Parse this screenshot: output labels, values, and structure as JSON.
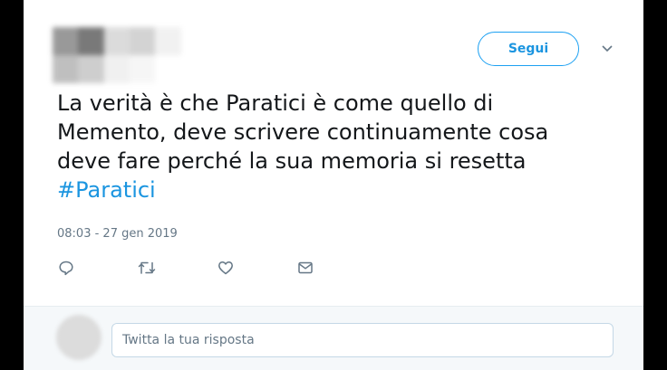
{
  "header": {
    "follow_label": "Segui"
  },
  "tweet": {
    "lines": [
      "La verità è che Paratici è come quello di",
      "Memento, deve scrivere continuamente cosa",
      "deve fare perché la sua memoria si resetta"
    ],
    "hashtag": "#Paratici",
    "timestamp": "08:03 - 27 gen 2019"
  },
  "actions": [
    "reply-icon",
    "retweet-icon",
    "like-icon",
    "message-icon"
  ],
  "reply": {
    "placeholder": "Twitta la tua risposta"
  },
  "colors": {
    "accent": "#1da1f2",
    "link": "#1b95e0",
    "text": "#14171a",
    "muted": "#657786"
  }
}
